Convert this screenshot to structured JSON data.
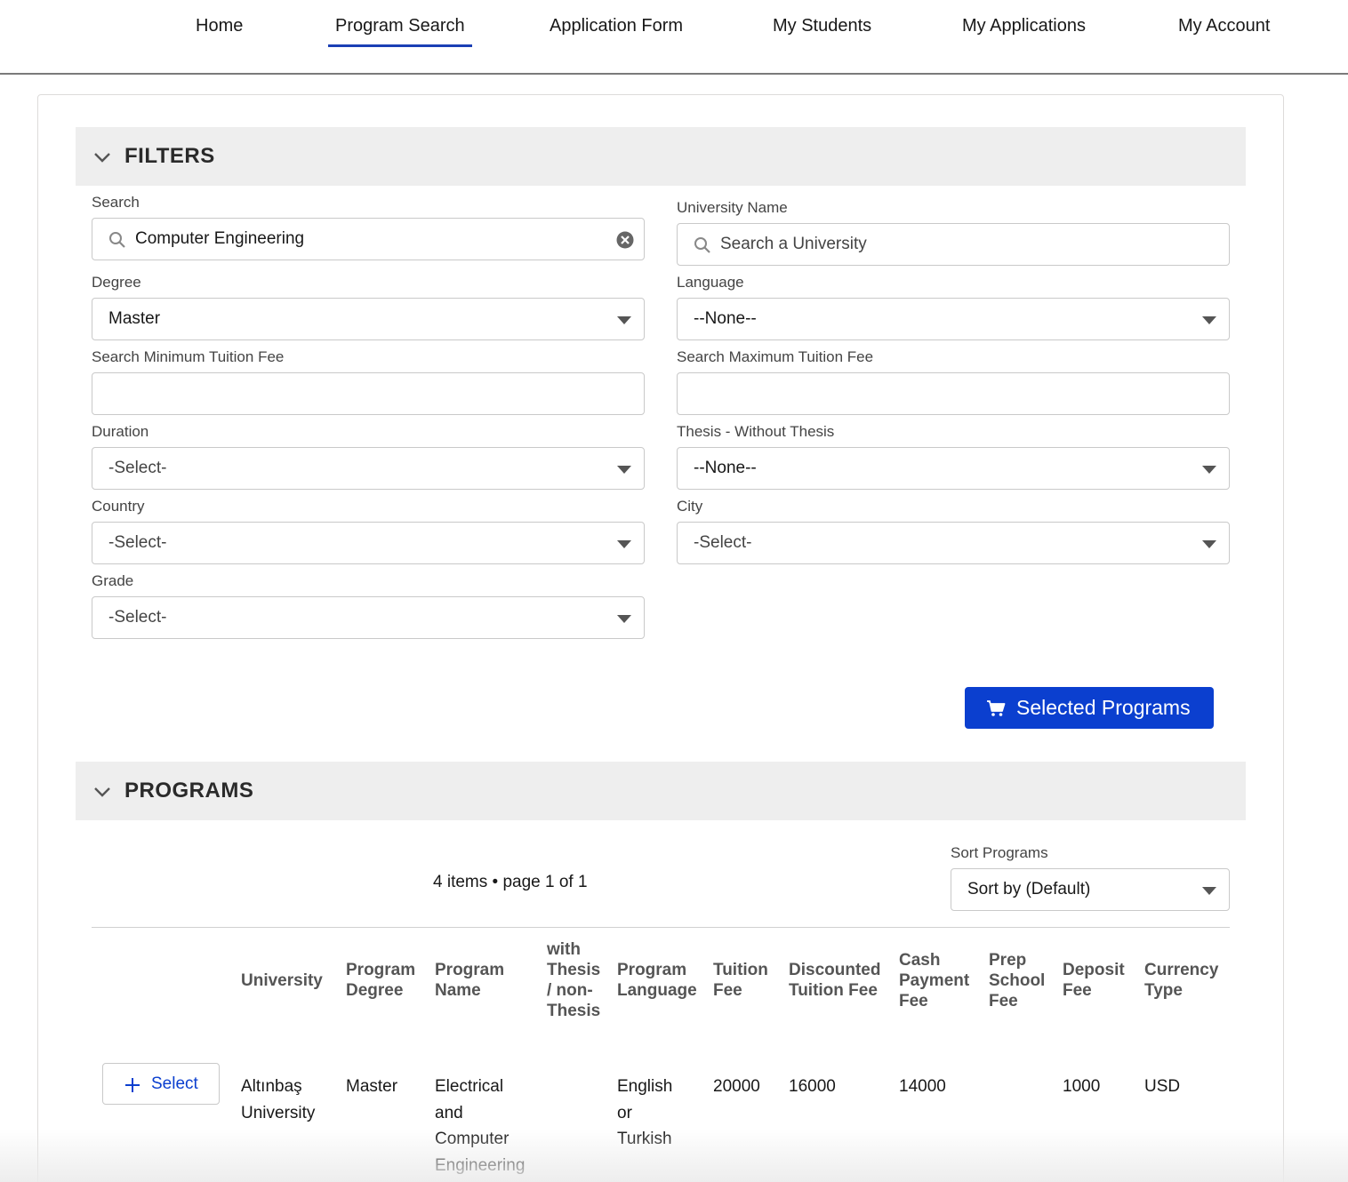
{
  "nav": {
    "items": [
      {
        "label": "Home"
      },
      {
        "label": "Program Search"
      },
      {
        "label": "Application Form"
      },
      {
        "label": "My Students"
      },
      {
        "label": "My Applications"
      },
      {
        "label": "My Account"
      }
    ],
    "active_index": 1
  },
  "filters": {
    "title": "FILTERS",
    "search": {
      "label": "Search",
      "value": "Computer Engineering"
    },
    "university": {
      "label": "University Name",
      "placeholder": "Search a University"
    },
    "degree": {
      "label": "Degree",
      "value": "Master"
    },
    "language": {
      "label": "Language",
      "value": "--None--"
    },
    "min_fee": {
      "label": "Search Minimum Tuition Fee",
      "value": ""
    },
    "max_fee": {
      "label": "Search Maximum Tuition Fee",
      "value": ""
    },
    "duration": {
      "label": "Duration",
      "value": "-Select-"
    },
    "thesis": {
      "label": "Thesis - Without Thesis",
      "value": "--None--"
    },
    "country": {
      "label": "Country",
      "value": "-Select-"
    },
    "city": {
      "label": "City",
      "value": "-Select-"
    },
    "grade": {
      "label": "Grade",
      "value": "-Select-"
    },
    "selected_programs_label": "Selected Programs"
  },
  "programs": {
    "title": "PROGRAMS",
    "summary": "4 items • page 1 of 1",
    "sort": {
      "label": "Sort Programs",
      "value": "Sort by (Default)"
    },
    "columns": [
      "University",
      "Program\nDegree",
      "Program\nName",
      "with\nThesis\n/ non-\nThesis",
      "Program\nLanguage",
      "Tuition\nFee",
      "Discounted\nTuition Fee",
      "Cash\nPayment\nFee",
      "Prep\nSchool\nFee",
      "Deposit\nFee",
      "Currency\nType"
    ],
    "rows": [
      {
        "select_label": "Select",
        "university": "Altınbaş\nUniversity",
        "degree": "Master",
        "name": "Electrical\nand\nComputer\nEngineering",
        "thesis": "",
        "language": "English\nor\nTurkish",
        "tuition": "20000",
        "discounted": "16000",
        "cash": "14000",
        "prep": "",
        "deposit": "1000",
        "currency": "USD"
      }
    ]
  },
  "colors": {
    "accent": "#0b3fcf",
    "nav_underline": "#1b3fb5",
    "section_bg": "#eeeeee"
  },
  "icons": [
    "chevron-down-icon",
    "search-icon",
    "clear-icon",
    "caret-down-icon",
    "cart-icon",
    "plus-icon"
  ]
}
